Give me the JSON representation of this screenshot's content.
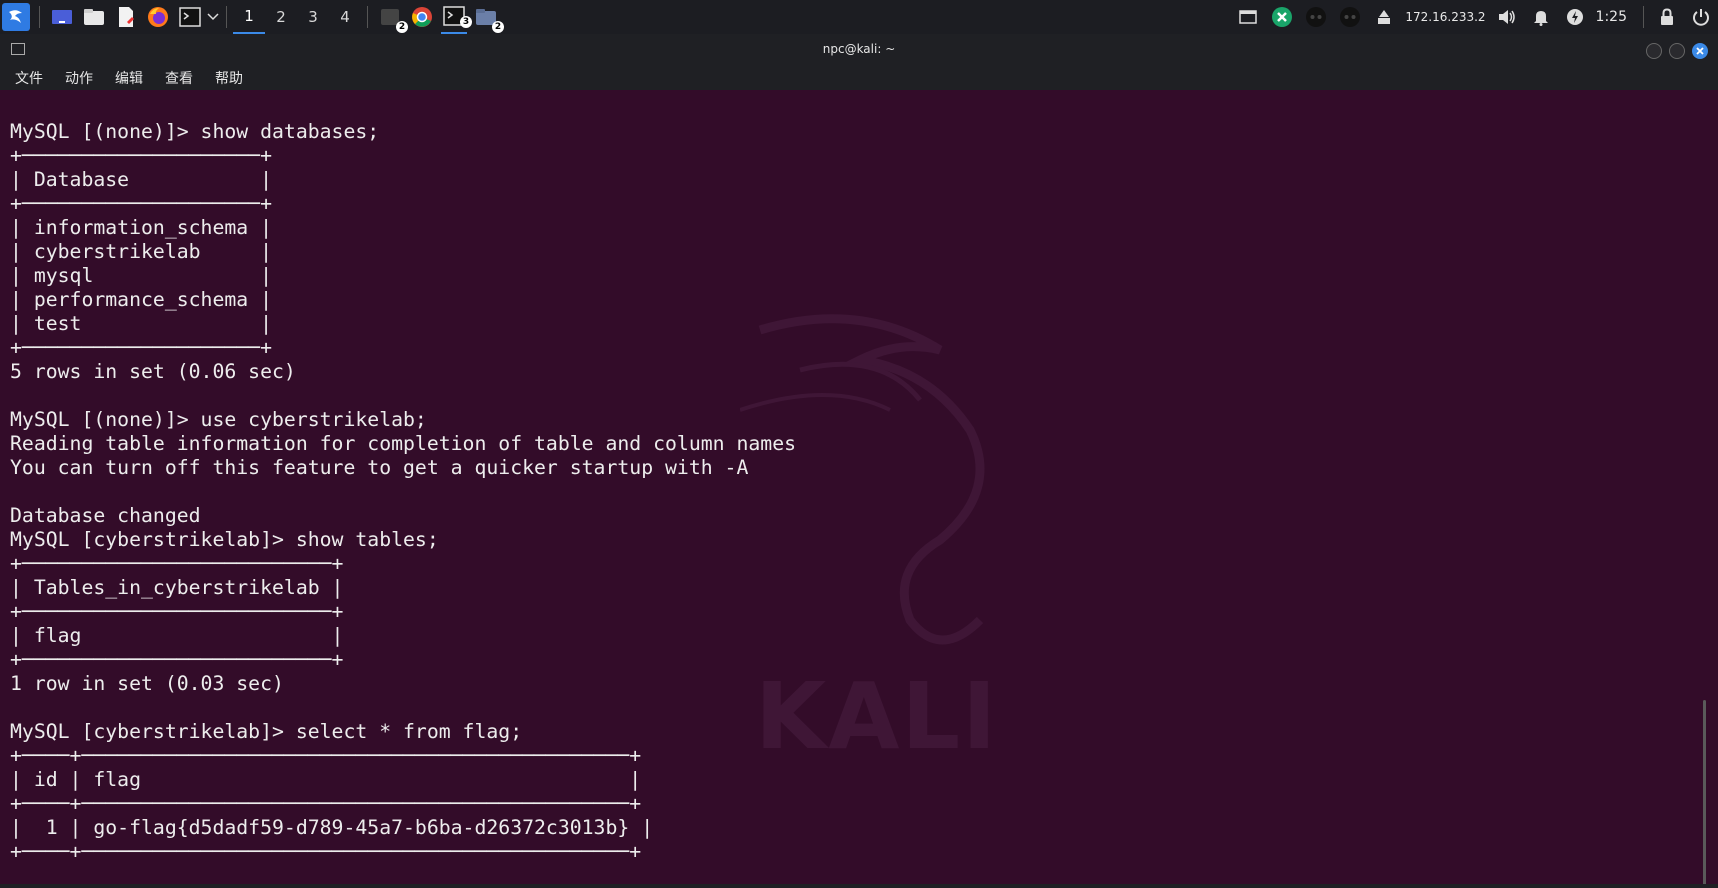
{
  "panel": {
    "workspaces": [
      "1",
      "2",
      "3",
      "4"
    ],
    "active_workspace": "1",
    "badges": {
      "app_group": "2",
      "terminal": "3",
      "files": "2"
    },
    "tray": {
      "ip": "172.16.233.2",
      "clock": "1:25"
    },
    "accent_color": "#3b8ae8"
  },
  "window": {
    "title": "npc@kali: ~",
    "menu": [
      "文件",
      "动作",
      "编辑",
      "查看",
      "帮助"
    ]
  },
  "watermark": "KALI",
  "terminal": {
    "background_color": "#330c29",
    "lines": [
      "MySQL [(none)]> show databases;",
      "+────────────────────+",
      "| Database           |",
      "+────────────────────+",
      "| information_schema |",
      "| cyberstrikelab     |",
      "| mysql              |",
      "| performance_schema |",
      "| test               |",
      "+────────────────────+",
      "5 rows in set (0.06 sec)",
      "",
      "MySQL [(none)]> use cyberstrikelab;",
      "Reading table information for completion of table and column names",
      "You can turn off this feature to get a quicker startup with -A",
      "",
      "Database changed",
      "MySQL [cyberstrikelab]> show tables;",
      "+──────────────────────────+",
      "| Tables_in_cyberstrikelab |",
      "+──────────────────────────+",
      "| flag                     |",
      "+──────────────────────────+",
      "1 row in set (0.03 sec)",
      "",
      "MySQL [cyberstrikelab]> select * from flag;",
      "+────+──────────────────────────────────────────────+",
      "| id | flag                                         |",
      "+────+──────────────────────────────────────────────+",
      "|  1 | go-flag{d5dadf59-d789-45a7-b6ba-d26372c3013b} |",
      "+────+──────────────────────────────────────────────+"
    ]
  }
}
